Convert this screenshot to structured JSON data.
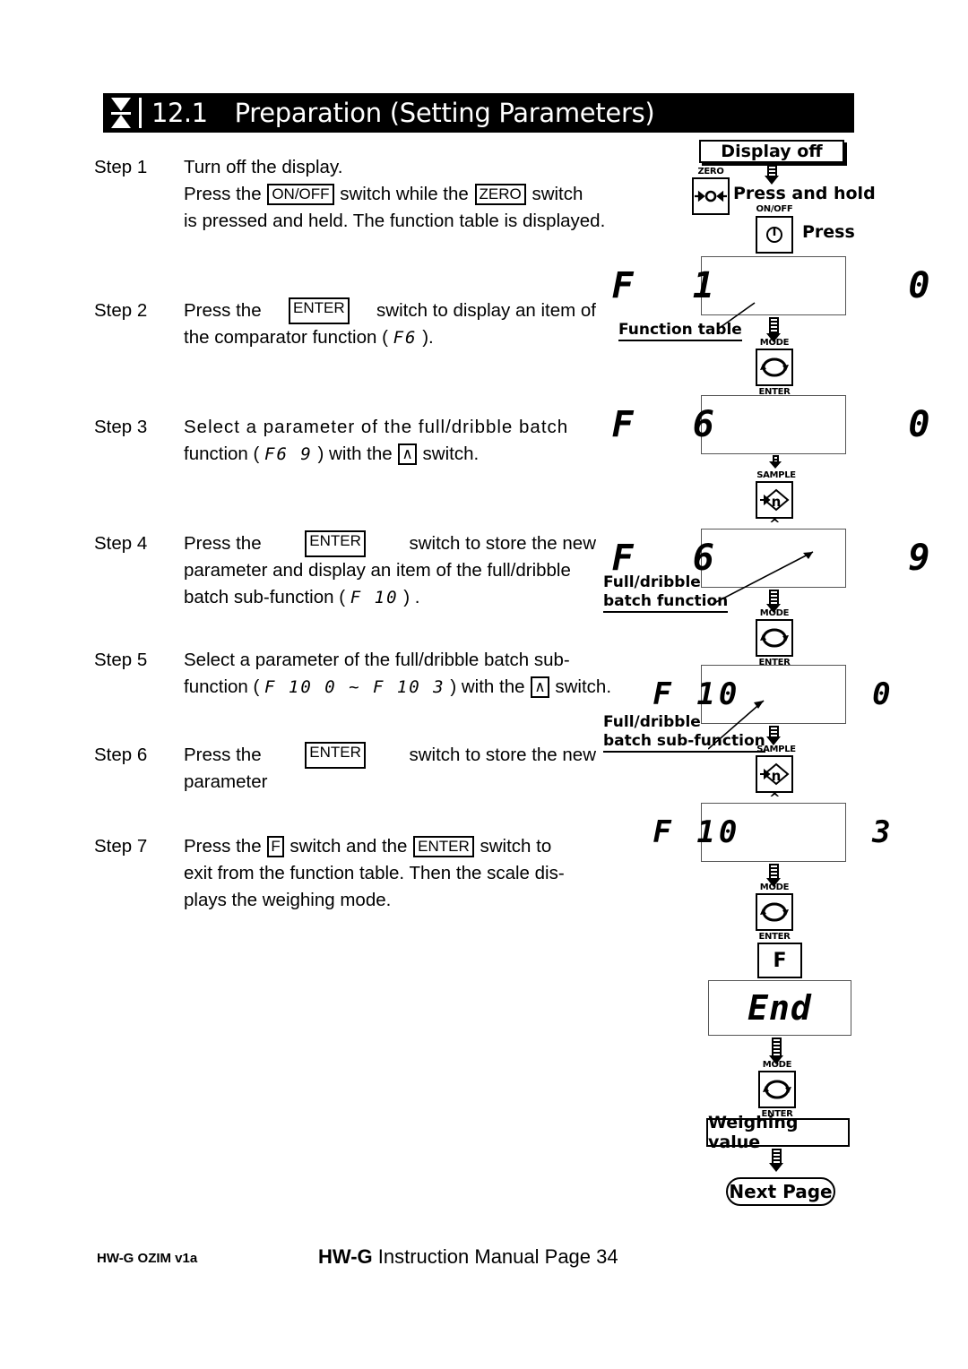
{
  "header": {
    "number": "12.1",
    "title": "Preparation (Setting Parameters)",
    "icon": "hourglass-icon"
  },
  "steps": [
    {
      "label": "Step 1",
      "lines": [
        "Turn off the display.",
        "Press the |ON/OFF| switch while the |ZERO| switch",
        "is pressed and held. The function table is displayed."
      ]
    },
    {
      "label": "Step 2",
      "lines": [
        "Press the |ENTER| switch to display an item of",
        "the comparator function ( [F6] )."
      ]
    },
    {
      "label": "Step 3",
      "lines": [
        "Select a parameter of the full/dribble batch",
        "function ( [F6 9] ) with the |∧| switch."
      ]
    },
    {
      "label": "Step 4",
      "lines": [
        "Press the |ENTER| switch to store the new",
        "parameter and display an item of the full/dribble",
        "batch sub-function ( [F 10] ) ."
      ]
    },
    {
      "label": "Step 5",
      "lines": [
        "Select a parameter of the full/dribble batch sub-",
        "function ( [F 10 0 ~ F 10 3] ) with the |∧| switch."
      ]
    },
    {
      "label": "Step 6",
      "lines": [
        "Press the |ENTER| switch to store the new",
        "parameter"
      ]
    },
    {
      "label": "Step 7",
      "lines": [
        "Press the |F| switch and the |ENTER| switch to",
        "exit from the function table. Then the scale dis-",
        "plays the weighing mode."
      ]
    }
  ],
  "step_text": {
    "s1_l1": "Turn off the display.",
    "s1_l2a": "Press the",
    "s1_key1": "ON/OFF",
    "s1_l2b": "switch while the",
    "s1_key2": "ZERO",
    "s1_l2c": "switch",
    "s1_l3": "is pressed and held. The function table is displayed.",
    "s2_a": "Press the",
    "s2_key": "ENTER",
    "s2_b": "switch to display an item of",
    "s2_c": "the comparator function (",
    "s2_seg": "F6",
    "s2_d": ").",
    "s3_a": "Select a parameter of the full/dribble batch",
    "s3_b": "function (",
    "s3_seg": "F6  9",
    "s3_c": ") with the",
    "s3_key": "∧",
    "s3_d": "switch.",
    "s4_a": "Press the",
    "s4_key": "ENTER",
    "s4_b": "switch to store the new",
    "s4_c": "parameter and display an item of the full/dribble",
    "s4_d": "batch sub-function (",
    "s4_seg": "F 10",
    "s4_e": ") .",
    "s5_a": "Select a parameter of the full/dribble batch sub-",
    "s5_b": "function (",
    "s5_seg": "F 10 0  ~  F 10 3",
    "s5_c": ") with the",
    "s5_key": "∧",
    "s5_d": "switch.",
    "s6_a": "Press the",
    "s6_key": "ENTER",
    "s6_b": "switch to store the new",
    "s6_c": "parameter",
    "s7_a": "Press the",
    "s7_key1": "F",
    "s7_b": "switch and the",
    "s7_key2": "ENTER",
    "s7_c": "switch to",
    "s7_d": "exit from the function table. Then the scale dis-",
    "s7_e": "plays the weighing mode."
  },
  "flowchart": {
    "display_off": "Display off",
    "zero_key_label": "ZERO",
    "zero_key_glyph": "➡O⬅",
    "press_and_hold": "Press and hold",
    "onoff_key_label": "ON/OFF",
    "onoff_key_glyph": "power-icon",
    "press": "Press",
    "lcd_1": "F  1       0",
    "callout_function_table": "Function table",
    "mode_label": "MODE",
    "enter_label": "ENTER",
    "sample_label": "SAMPLE",
    "lcd_2": "F  6       0",
    "lcd_3": "F  6       9",
    "callout_full_dribble_fn_l1": "Full/dribble",
    "callout_full_dribble_fn_l2": "batch function",
    "lcd_4": "F 10      0",
    "callout_full_dribble_sub_l1": "Full/dribble",
    "callout_full_dribble_sub_l2": "batch sub-function",
    "lcd_5": "F 10      3",
    "f_key_label": "F",
    "lcd_end": "End",
    "weighing_value": "Weighing value",
    "next_page": "Next Page"
  },
  "footer": {
    "left": "HW-G OZIM v1a",
    "center_bold": "HW-G",
    "center_rest": " Instruction Manual Page 34"
  }
}
